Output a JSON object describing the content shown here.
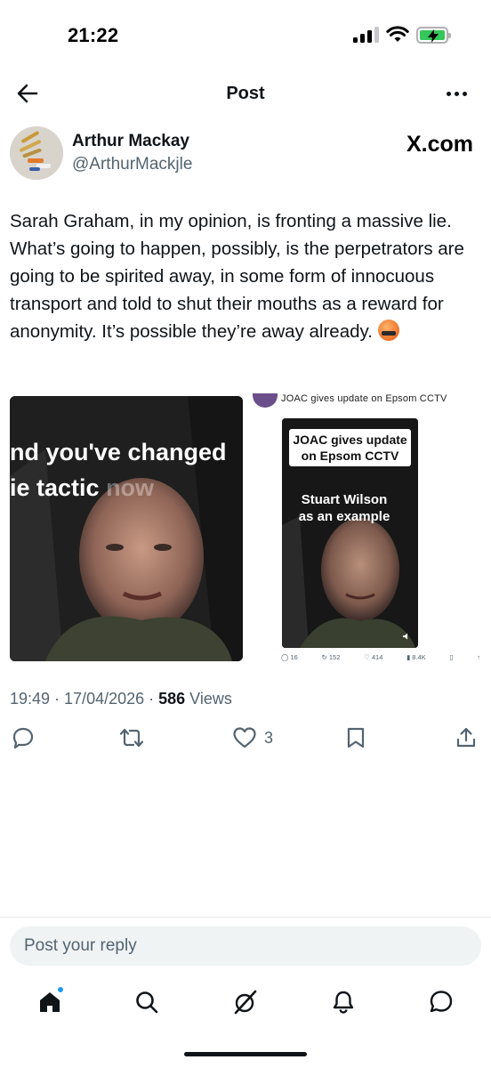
{
  "status_bar": {
    "time": "21:22"
  },
  "header": {
    "title": "Post"
  },
  "author": {
    "name": "Arthur Mackay",
    "handle": "@ArthurMackjle",
    "source_label": "X.com"
  },
  "post": {
    "text": "Sarah Graham, in my opinion,  is fronting a massive lie. What’s going to happen, possibly, is the perpetrators are going to be spirited away, in some form of innocuous transport and told to shut their mouths as a reward for anonymity. It’s possible they’re away already."
  },
  "media": {
    "left": {
      "caption_line1": "nd you've changed",
      "caption_line2_bright": "ie tactic",
      "caption_line2_dim": " now"
    },
    "right": {
      "header": "JOAC gives update on Epsom CCTV",
      "tag_line1": "JOAC gives update",
      "tag_line2": "on Epsom CCTV",
      "sub_line1": "Stuart Wilson",
      "sub_line2": "as an example",
      "stats": {
        "replies": "16",
        "reposts": "152",
        "likes": "414",
        "views": "8.4K"
      }
    }
  },
  "meta": {
    "time_date": "19:49 · 17/04/2026 · ",
    "views_count": "586",
    "views_label": " Views"
  },
  "actions": {
    "likes": "3"
  },
  "reply": {
    "placeholder": "Post your reply"
  },
  "tabbar": {
    "icons": [
      "home-icon",
      "search-icon",
      "grok-icon",
      "bell-icon",
      "messages-icon"
    ]
  },
  "colors": {
    "text_primary": "#0f1419",
    "text_secondary": "#536471",
    "accent": "#1d9bf0",
    "battery": "#34c759"
  }
}
